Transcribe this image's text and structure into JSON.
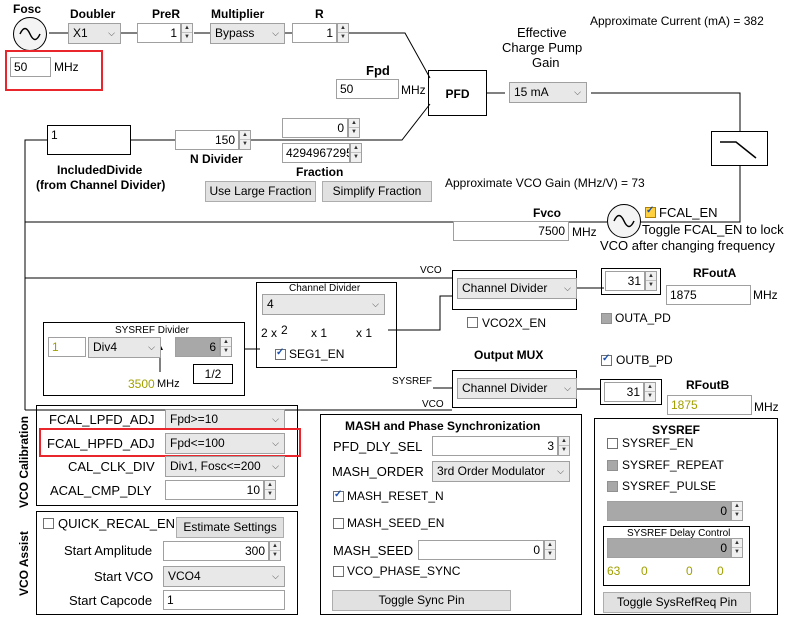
{
  "top": {
    "fosc_label": "Fosc",
    "fosc_value": "50",
    "fosc_unit": "MHz",
    "doubler_label": "Doubler",
    "doubler_value": "X1",
    "prer_label": "PreR",
    "prer_value": "1",
    "multiplier_label": "Multiplier",
    "multiplier_value": "Bypass",
    "r_label": "R",
    "r_value": "1",
    "approx_current": "Approximate Current (mA) = 382",
    "fpd_label": "Fpd",
    "fpd_value": "50",
    "fpd_unit": "MHz",
    "pfd_label": "PFD",
    "ecp_label_1": "Effective",
    "ecp_label_2": "Charge Pump",
    "ecp_label_3": "Gain",
    "cp_gain_value": "15 mA"
  },
  "ndiv": {
    "included_value": "1",
    "included_label_1": "IncludedDivide",
    "included_label_2": "(from Channel Divider)",
    "n_value": "150",
    "n_label": "N Divider",
    "frac_num": "0",
    "frac_den": "4294967295",
    "fraction_label": "Fraction",
    "use_large_fraction": "Use Large Fraction",
    "simplify_fraction": "Simplify Fraction",
    "approx_vco_gain": "Approximate VCO Gain (MHz/V) =  73"
  },
  "vco": {
    "fvco_label": "Fvco",
    "fvco_value": "7500",
    "fvco_unit": "MHz",
    "fcal_en": "FCAL_EN",
    "toggle_note_1": "Toggle FCAL_EN to lock",
    "toggle_note_2": "VCO after changing frequency",
    "vco_wire_label": "VCO",
    "vco_wire_label_2": "VCO",
    "sysref_wire_label": "SYSREF"
  },
  "chdiv": {
    "title": "Channel  Divider",
    "value": "4",
    "seg_2x": "2 x",
    "seg_2": "2",
    "seg_x1a": "x 1",
    "seg_x1b": "x 1",
    "seg1_en": "SEG1_EN"
  },
  "sysrefdiv": {
    "title": "SYSREF Divider",
    "pre_value": "1",
    "div_value": "Div4",
    "div_num": "6",
    "freq_value": "3500",
    "freq_unit": "MHz",
    "half": "1/2"
  },
  "outa": {
    "mux_value": "Channel Divider",
    "vco2x_en": "VCO2X_EN",
    "pwr_value": "31",
    "label": "RFoutA",
    "freq": "1875",
    "unit": "MHz",
    "pd": "OUTA_PD"
  },
  "outb": {
    "mux_label": "Output MUX",
    "pd": "OUTB_PD",
    "mux_value": "Channel Divider",
    "pwr_value": "31",
    "label": "RFoutB",
    "freq": "1875",
    "unit": "MHz"
  },
  "vcocal": {
    "section_label": "VCO Calibration",
    "lpfd_label": "FCAL_LPFD_ADJ",
    "lpfd_value": "Fpd>=10",
    "hpfd_label": "FCAL_HPFD_ADJ",
    "hpfd_value": "Fpd<=100",
    "clk_label": "CAL_CLK_DIV",
    "clk_value": "Div1, Fosc<=200",
    "acal_label": "ACAL_CMP_DLY",
    "acal_value": "10"
  },
  "vcoassist": {
    "section_label": "VCO Assist",
    "quick_recal": "QUICK_RECAL_EN",
    "estimate": "Estimate Settings",
    "start_amp_label": "Start Amplitude",
    "start_amp_value": "300",
    "start_vco_label": "Start VCO",
    "start_vco_value": "VCO4",
    "start_cap_label": "Start Capcode",
    "start_cap_value": "1"
  },
  "mash": {
    "title": "MASH and Phase Synchronization",
    "pfd_dly_label": "PFD_DLY_SEL",
    "pfd_dly_value": "3",
    "order_label": "MASH_ORDER",
    "order_value": "3rd Order Modulator",
    "reset_n": "MASH_RESET_N",
    "seed_en": "MASH_SEED_EN",
    "seed_label": "MASH_SEED",
    "seed_value": "0",
    "phase_sync": "VCO_PHASE_SYNC",
    "toggle_sync": "Toggle Sync Pin"
  },
  "sysref": {
    "title": "SYSREF",
    "en": "SYSREF_EN",
    "repeat": "SYSREF_REPEAT",
    "pulse": "SYSREF_PULSE",
    "value": "0",
    "delay_title": "SYSREF Delay Control",
    "delay_value": "0",
    "d1": "63",
    "d2": "0",
    "d3": "0",
    "d4": "0",
    "toggle_req": "Toggle SysRefReq Pin"
  }
}
